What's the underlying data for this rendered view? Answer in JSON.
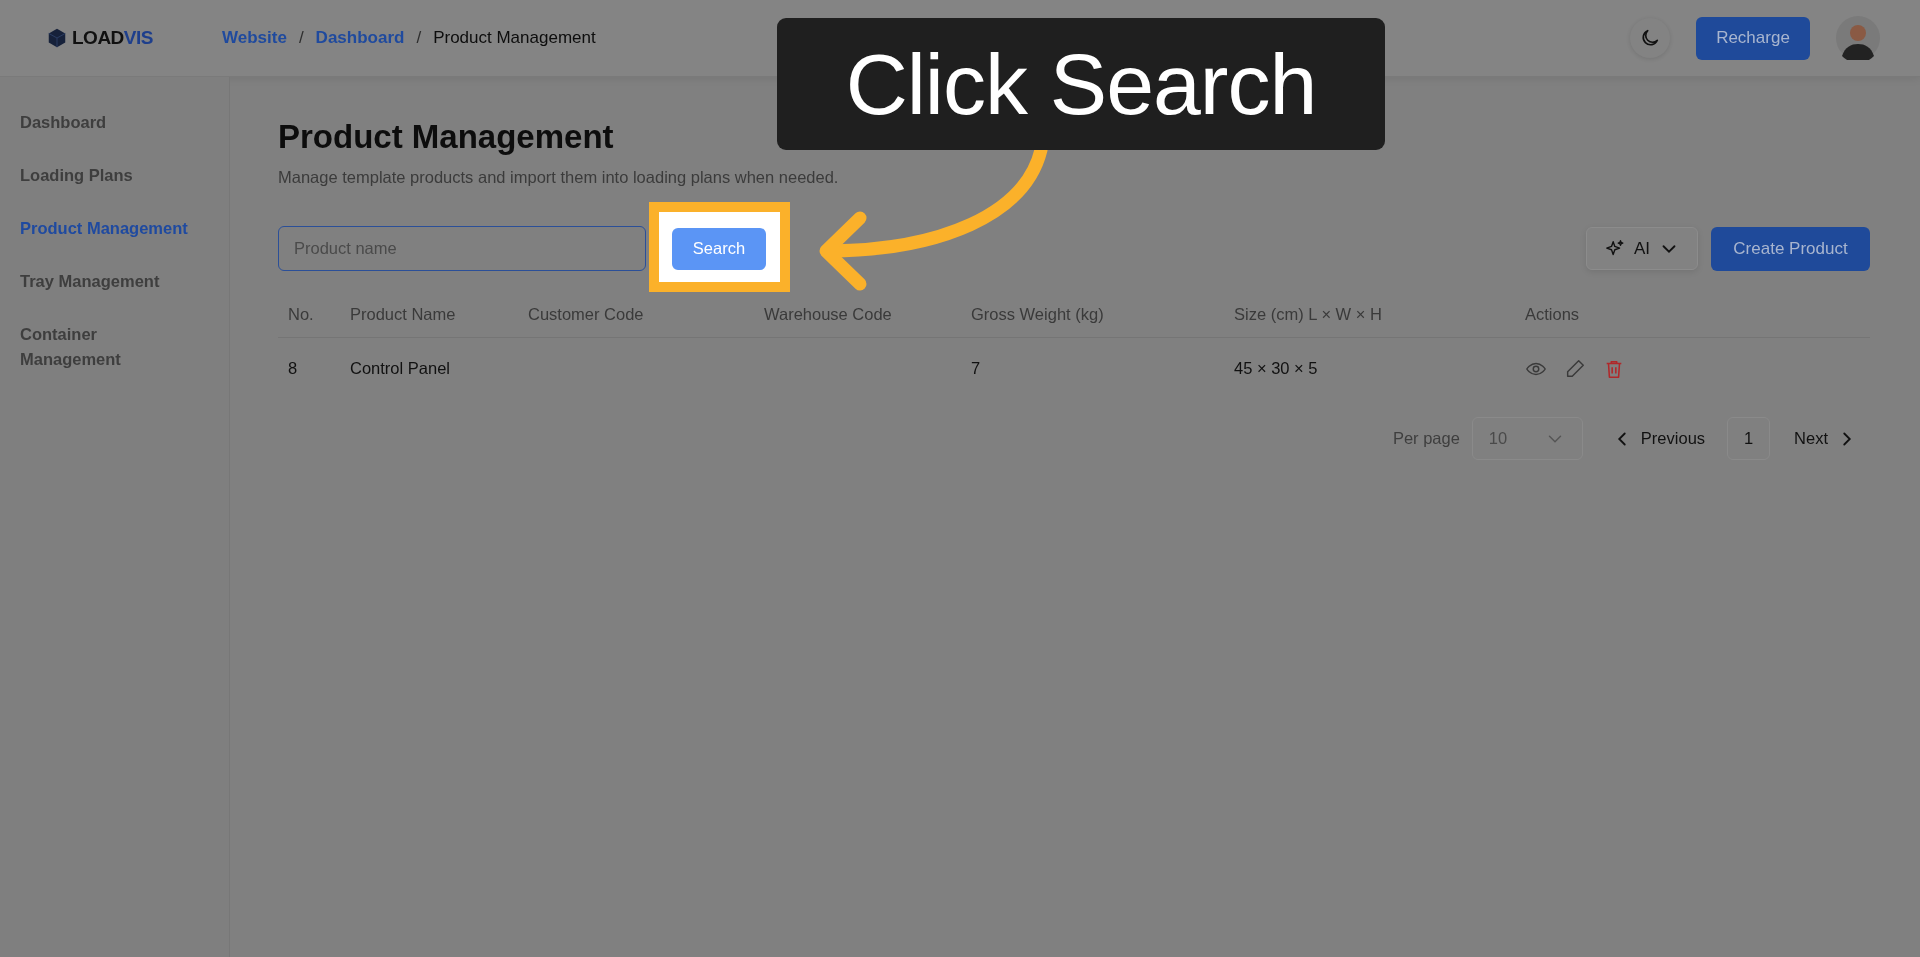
{
  "brand": {
    "prefix": "LOAD",
    "suffix": "VIS"
  },
  "breadcrumb_separator": "/",
  "breadcrumb": [
    {
      "label": "Website",
      "kind": "link"
    },
    {
      "label": "Dashboard",
      "kind": "link"
    },
    {
      "label": "Product Management",
      "kind": "current"
    }
  ],
  "header": {
    "recharge_button": "Recharge"
  },
  "sidebar": {
    "items": [
      {
        "label": "Dashboard",
        "selected": false
      },
      {
        "label": "Loading Plans",
        "selected": false
      },
      {
        "label": "Product Management",
        "selected": true
      },
      {
        "label": "Tray Management",
        "selected": false
      },
      {
        "label": "Container Management",
        "selected": false
      }
    ]
  },
  "page": {
    "title": "Product Management",
    "subtitle": "Manage template products and import them into loading plans when needed."
  },
  "toolbar": {
    "search": {
      "placeholder": "Product name"
    },
    "search_button": "Search",
    "ai_button": "AI",
    "create_button": "Create Product"
  },
  "table": {
    "columns": [
      "No.",
      "Product Name",
      "Customer Code",
      "Warehouse Code",
      "Gross Weight (kg)",
      "Size (cm) L × W × H",
      "Actions"
    ],
    "rows": [
      {
        "cells": [
          "8",
          "Control Panel",
          "",
          "",
          "7",
          "45 × 30 × 5"
        ]
      }
    ]
  },
  "pagination": {
    "per_page_label": "Per page",
    "per_page": "10",
    "previous": "Previous",
    "page": "1",
    "next": "Next"
  },
  "callout": {
    "text": "Click Search"
  }
}
